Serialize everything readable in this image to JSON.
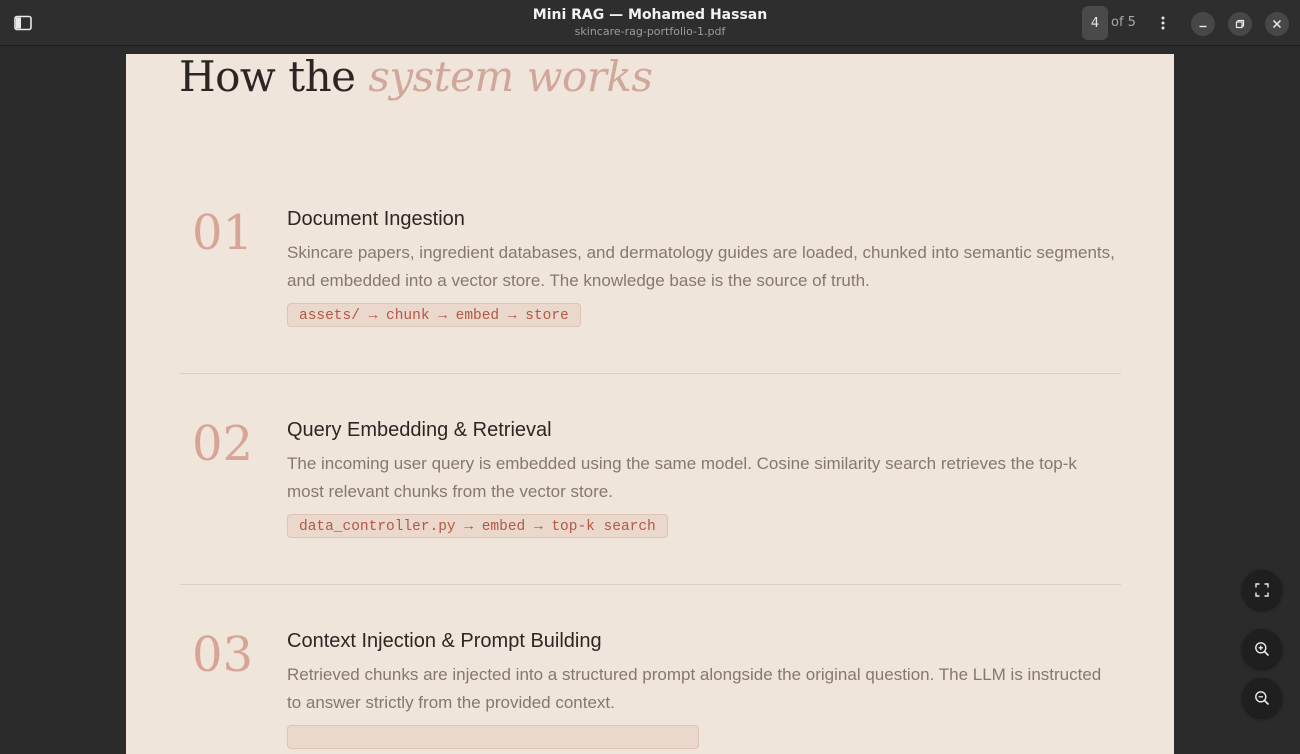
{
  "window": {
    "title": "Mini RAG — Mohamed Hassan",
    "subtitle": "skincare-rag-portfolio-1.pdf",
    "current_page": "4",
    "page_total": "of 5"
  },
  "icons": {
    "sidebar": "sidebar-toggle-icon",
    "menu": "kebab-menu-icon",
    "minimize": "minimize-icon",
    "maximize": "maximize-icon",
    "close": "close-icon",
    "fit": "fit-page-icon",
    "zoom_in": "zoom-in-icon",
    "zoom_out": "zoom-out-icon"
  },
  "colors": {
    "page_bg": "#efe5da",
    "accent": "#d0a79a",
    "code_text": "#b45744"
  },
  "document": {
    "heading_plain": "How the ",
    "heading_accent": "system works",
    "steps": [
      {
        "number": "01",
        "title": "Document Ingestion",
        "description": "Skincare papers, ingredient databases, and dermatology guides are loaded, chunked into semantic segments, and embedded into a vector store. The knowledge base is the source of truth.",
        "code": "assets/ → chunk → embed → store"
      },
      {
        "number": "02",
        "title": "Query Embedding & Retrieval",
        "description": "The incoming user query is embedded using the same model. Cosine similarity search retrieves the top-k most relevant chunks from the vector store.",
        "code": "data_controller.py → embed → top-k search"
      },
      {
        "number": "03",
        "title": "Context Injection & Prompt Building",
        "description": "Retrieved chunks are injected into a structured prompt alongside the original question. The LLM is instructed to answer strictly from the provided context.",
        "code": ""
      }
    ]
  }
}
